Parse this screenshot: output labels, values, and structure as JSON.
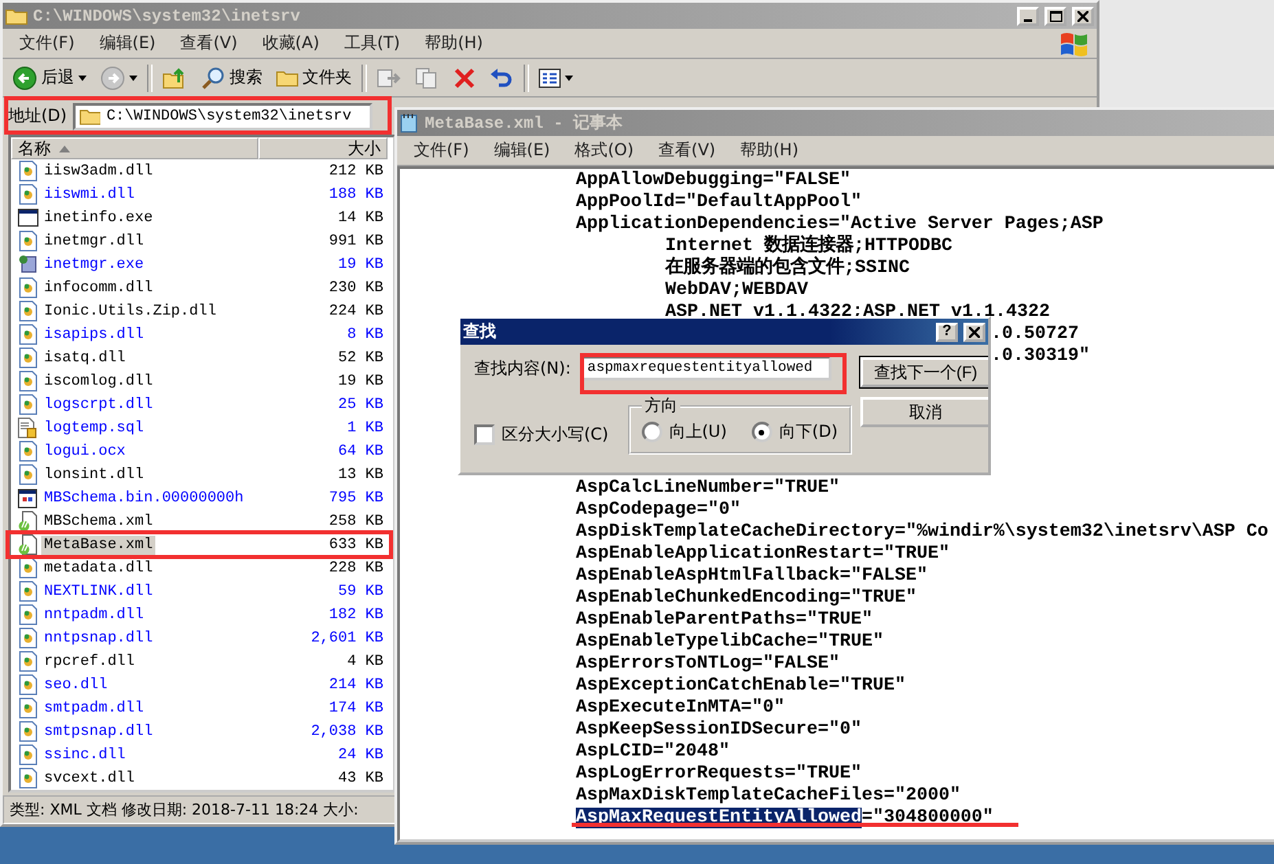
{
  "explorer": {
    "title": "C:\\WINDOWS\\system32\\inetsrv",
    "menu": [
      "文件(F)",
      "编辑(E)",
      "查看(V)",
      "收藏(A)",
      "工具(T)",
      "帮助(H)"
    ],
    "toolbar": [
      {
        "kind": "back",
        "label": "后退"
      },
      {
        "kind": "forward"
      },
      {
        "kind": "up"
      },
      {
        "kind": "search",
        "label": "搜索"
      },
      {
        "kind": "folders",
        "label": "文件夹"
      },
      {
        "kind": "move"
      },
      {
        "kind": "copy"
      },
      {
        "kind": "delete"
      },
      {
        "kind": "undo"
      },
      {
        "kind": "views"
      }
    ],
    "address": {
      "label": "地址(D)",
      "value": "C:\\WINDOWS\\system32\\inetsrv"
    },
    "columns": [
      {
        "label": "名称",
        "sorted": true
      },
      {
        "label": "大小",
        "sorted": false
      }
    ],
    "files": [
      {
        "name": "iisw3adm.dll",
        "size": "212 KB",
        "kind": "dll",
        "compressed": false,
        "selected": false
      },
      {
        "name": "iiswmi.dll",
        "size": "188 KB",
        "kind": "dll",
        "compressed": true,
        "selected": false
      },
      {
        "name": "inetinfo.exe",
        "size": "14 KB",
        "kind": "window",
        "compressed": false,
        "selected": false
      },
      {
        "name": "inetmgr.dll",
        "size": "991 KB",
        "kind": "dll",
        "compressed": false,
        "selected": false
      },
      {
        "name": "inetmgr.exe",
        "size": "19 KB",
        "kind": "app",
        "compressed": true,
        "selected": false
      },
      {
        "name": "infocomm.dll",
        "size": "230 KB",
        "kind": "dll",
        "compressed": false,
        "selected": false
      },
      {
        "name": "Ionic.Utils.Zip.dll",
        "size": "224 KB",
        "kind": "dll",
        "compressed": false,
        "selected": false
      },
      {
        "name": "isapips.dll",
        "size": "8 KB",
        "kind": "dll",
        "compressed": true,
        "selected": false
      },
      {
        "name": "isatq.dll",
        "size": "52 KB",
        "kind": "dll",
        "compressed": false,
        "selected": false
      },
      {
        "name": "iscomlog.dll",
        "size": "19 KB",
        "kind": "dll",
        "compressed": false,
        "selected": false
      },
      {
        "name": "logscrpt.dll",
        "size": "25 KB",
        "kind": "dll",
        "compressed": true,
        "selected": false
      },
      {
        "name": "logtemp.sql",
        "size": "1 KB",
        "kind": "script",
        "compressed": true,
        "selected": false
      },
      {
        "name": "logui.ocx",
        "size": "64 KB",
        "kind": "dll",
        "compressed": true,
        "selected": false
      },
      {
        "name": "lonsint.dll",
        "size": "13 KB",
        "kind": "dll",
        "compressed": false,
        "selected": false
      },
      {
        "name": "MBSchema.bin.00000000h",
        "size": "795 KB",
        "kind": "binary",
        "compressed": true,
        "selected": false
      },
      {
        "name": "MBSchema.xml",
        "size": "258 KB",
        "kind": "xml",
        "compressed": false,
        "selected": false
      },
      {
        "name": "MetaBase.xml",
        "size": "633 KB",
        "kind": "xml",
        "compressed": false,
        "selected": true
      },
      {
        "name": "metadata.dll",
        "size": "228 KB",
        "kind": "dll",
        "compressed": false,
        "selected": false
      },
      {
        "name": "NEXTLINK.dll",
        "size": "59 KB",
        "kind": "dll",
        "compressed": true,
        "selected": false
      },
      {
        "name": "nntpadm.dll",
        "size": "182 KB",
        "kind": "dll",
        "compressed": true,
        "selected": false
      },
      {
        "name": "nntpsnap.dll",
        "size": "2,601 KB",
        "kind": "dll",
        "compressed": true,
        "selected": false
      },
      {
        "name": "rpcref.dll",
        "size": "4 KB",
        "kind": "dll",
        "compressed": false,
        "selected": false
      },
      {
        "name": "seo.dll",
        "size": "214 KB",
        "kind": "dll",
        "compressed": true,
        "selected": false
      },
      {
        "name": "smtpadm.dll",
        "size": "174 KB",
        "kind": "dll",
        "compressed": true,
        "selected": false
      },
      {
        "name": "smtpsnap.dll",
        "size": "2,038 KB",
        "kind": "dll",
        "compressed": true,
        "selected": false
      },
      {
        "name": "ssinc.dll",
        "size": "24 KB",
        "kind": "dll",
        "compressed": true,
        "selected": false
      },
      {
        "name": "svcext.dll",
        "size": "43 KB",
        "kind": "dll",
        "compressed": false,
        "selected": false
      }
    ],
    "status": "类型: XML 文档 修改日期: 2018-7-11 18:24 大小:"
  },
  "notepad": {
    "title": "MetaBase.xml - 记事本",
    "menu": [
      "文件(F)",
      "编辑(E)",
      "格式(O)",
      "查看(V)",
      "帮助(H)"
    ],
    "lines": [
      {
        "kind": "top",
        "text": "AppAllowDebugging=\"FALSE\""
      },
      {
        "kind": "top",
        "text": "AppPoolId=\"DefaultAppPool\""
      },
      {
        "kind": "top",
        "text": "ApplicationDependencies=\"Active Server Pages;ASP"
      },
      {
        "kind": "sub",
        "text": "Internet 数据连接器;HTTPODBC"
      },
      {
        "kind": "sub",
        "text": "在服务器端的包含文件;SSINC"
      },
      {
        "kind": "sub",
        "text": "WebDAV;WEBDAV"
      },
      {
        "kind": "sub",
        "text": "ASP.NET v1.1.4322;ASP.NET v1.1.4322"
      },
      {
        "kind": "tail",
        "text": ".0.50727"
      },
      {
        "kind": "tail",
        "text": ".0.30319\""
      },
      {
        "kind": "hidden"
      },
      {
        "kind": "hidden"
      },
      {
        "kind": "hidden"
      },
      {
        "kind": "hidden"
      },
      {
        "kind": "hidden"
      },
      {
        "kind": "top",
        "text": "AspCalcLineNumber=\"TRUE\""
      },
      {
        "kind": "top",
        "text": "AspCodepage=\"0\""
      },
      {
        "kind": "top",
        "text": "AspDiskTemplateCacheDirectory=\"%windir%\\system32\\inetsrv\\ASP Co"
      },
      {
        "kind": "top",
        "text": "AspEnableApplicationRestart=\"TRUE\""
      },
      {
        "kind": "top",
        "text": "AspEnableAspHtmlFallback=\"FALSE\""
      },
      {
        "kind": "top",
        "text": "AspEnableChunkedEncoding=\"TRUE\""
      },
      {
        "kind": "top",
        "text": "AspEnableParentPaths=\"TRUE\""
      },
      {
        "kind": "top",
        "text": "AspEnableTypelibCache=\"TRUE\""
      },
      {
        "kind": "top",
        "text": "AspErrorsToNTLog=\"FALSE\""
      },
      {
        "kind": "top",
        "text": "AspExceptionCatchEnable=\"TRUE\""
      },
      {
        "kind": "top",
        "text": "AspExecuteInMTA=\"0\""
      },
      {
        "kind": "top",
        "text": "AspKeepSessionIDSecure=\"0\""
      },
      {
        "kind": "top",
        "text": "AspLCID=\"2048\""
      },
      {
        "kind": "top",
        "text": "AspLogErrorRequests=\"TRUE\""
      },
      {
        "kind": "top",
        "text": "AspMaxDiskTemplateCacheFiles=\"2000\""
      },
      {
        "kind": "top",
        "parts": [
          {
            "text": "AspMaxRequestEntityAllowed",
            "selected": true
          },
          {
            "text": "=\"304800000\"",
            "selected": false
          }
        ]
      }
    ]
  },
  "find_dialog": {
    "title": "查找",
    "help": "?",
    "find_label": "查找内容(N):",
    "find_value": "aspmaxrequestentityallowed",
    "buttons": [
      {
        "label": "查找下一个(F)",
        "focused": true
      },
      {
        "label": "取消",
        "focused": false
      }
    ],
    "match_case": {
      "label": "区分大小写(C)",
      "checked": false
    },
    "direction": {
      "label": "方向",
      "options": [
        {
          "label": "向上(U)",
          "selected": false
        },
        {
          "label": "向下(D)",
          "selected": true
        }
      ]
    }
  }
}
